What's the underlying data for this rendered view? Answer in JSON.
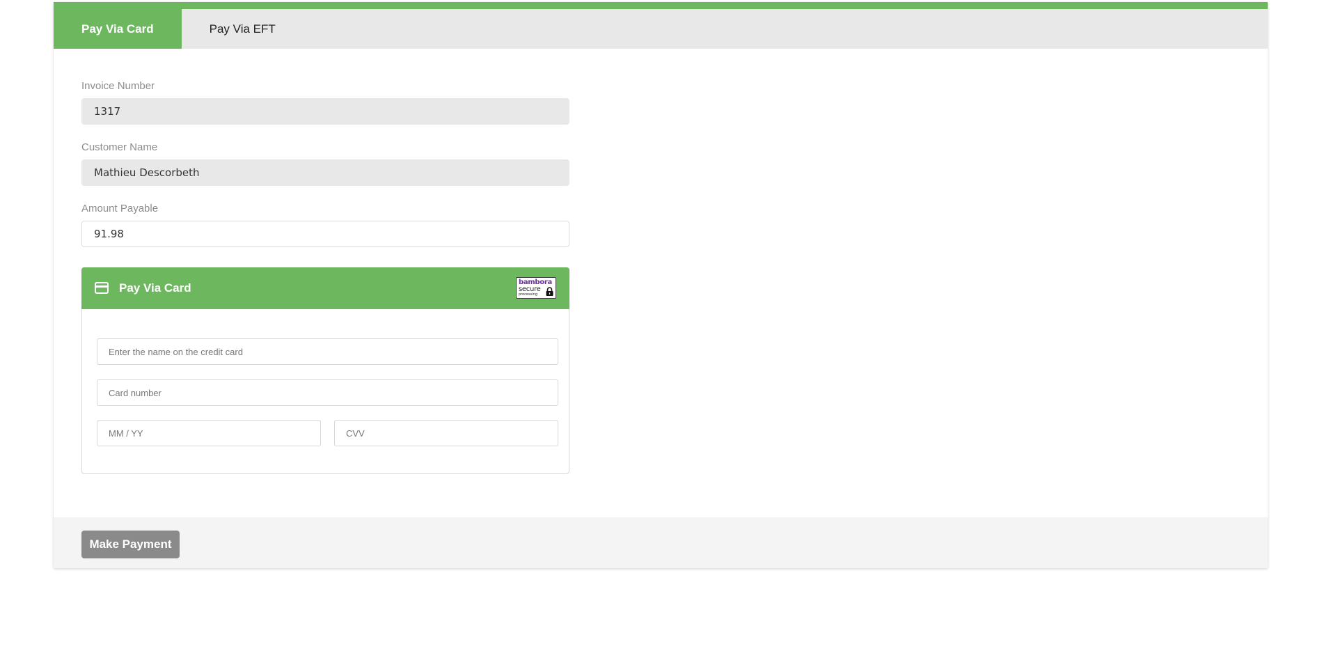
{
  "tabs": [
    {
      "label": "Pay Via Card",
      "active": true
    },
    {
      "label": "Pay Via EFT",
      "active": false
    }
  ],
  "form": {
    "invoice": {
      "label": "Invoice Number",
      "value": "1317"
    },
    "customer": {
      "label": "Customer Name",
      "value": "Mathieu Descorbeth"
    },
    "amount": {
      "label": "Amount Payable",
      "value": "91.98"
    }
  },
  "card_panel": {
    "title": "Pay Via Card",
    "icon": "credit-card-icon",
    "badge": {
      "line1": "bambora",
      "line2": "secure",
      "line3": "processing",
      "icon": "lock-icon"
    },
    "name_placeholder": "Enter the name on the credit card",
    "number_placeholder": "Card number",
    "expiry_placeholder": "MM / YY",
    "cvv_placeholder": "CVV"
  },
  "footer": {
    "pay_label": "Make Payment"
  },
  "colors": {
    "accent": "#6db85f",
    "tab_bar": "#e8e8e8",
    "button": "#8a8a8a",
    "footer_bg": "#f4f4f4"
  }
}
